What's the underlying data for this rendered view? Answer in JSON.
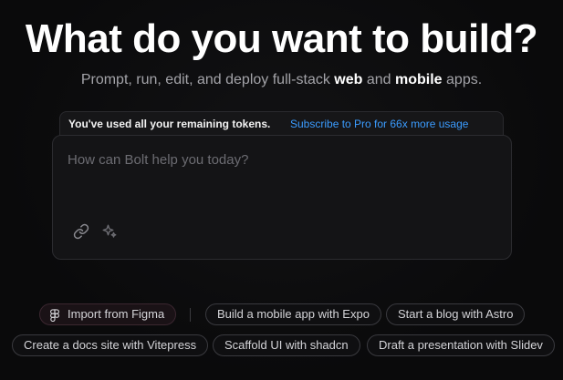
{
  "hero": {
    "title": "What do you want to build?",
    "subtitle_prefix": "Prompt, run, edit, and deploy full-stack ",
    "subtitle_web": "web",
    "subtitle_and": " and ",
    "subtitle_mobile": "mobile",
    "subtitle_suffix": " apps."
  },
  "banner": {
    "message": "You've used all your remaining tokens.",
    "cta": "Subscribe to Pro for 66x more usage",
    "cta_color": "#3b9cff"
  },
  "prompt": {
    "placeholder": "How can Bolt help you today?",
    "value": "",
    "attach_icon": "link-icon",
    "enhance_icon": "sparkles-icon"
  },
  "suggestions": {
    "import_figma": "Import from Figma",
    "row1": [
      "Build a mobile app with Expo",
      "Start a blog with Astro"
    ],
    "row2": [
      "Create a docs site with Vitepress",
      "Scaffold UI with shadcn",
      "Draft a presentation with Slidev"
    ]
  }
}
